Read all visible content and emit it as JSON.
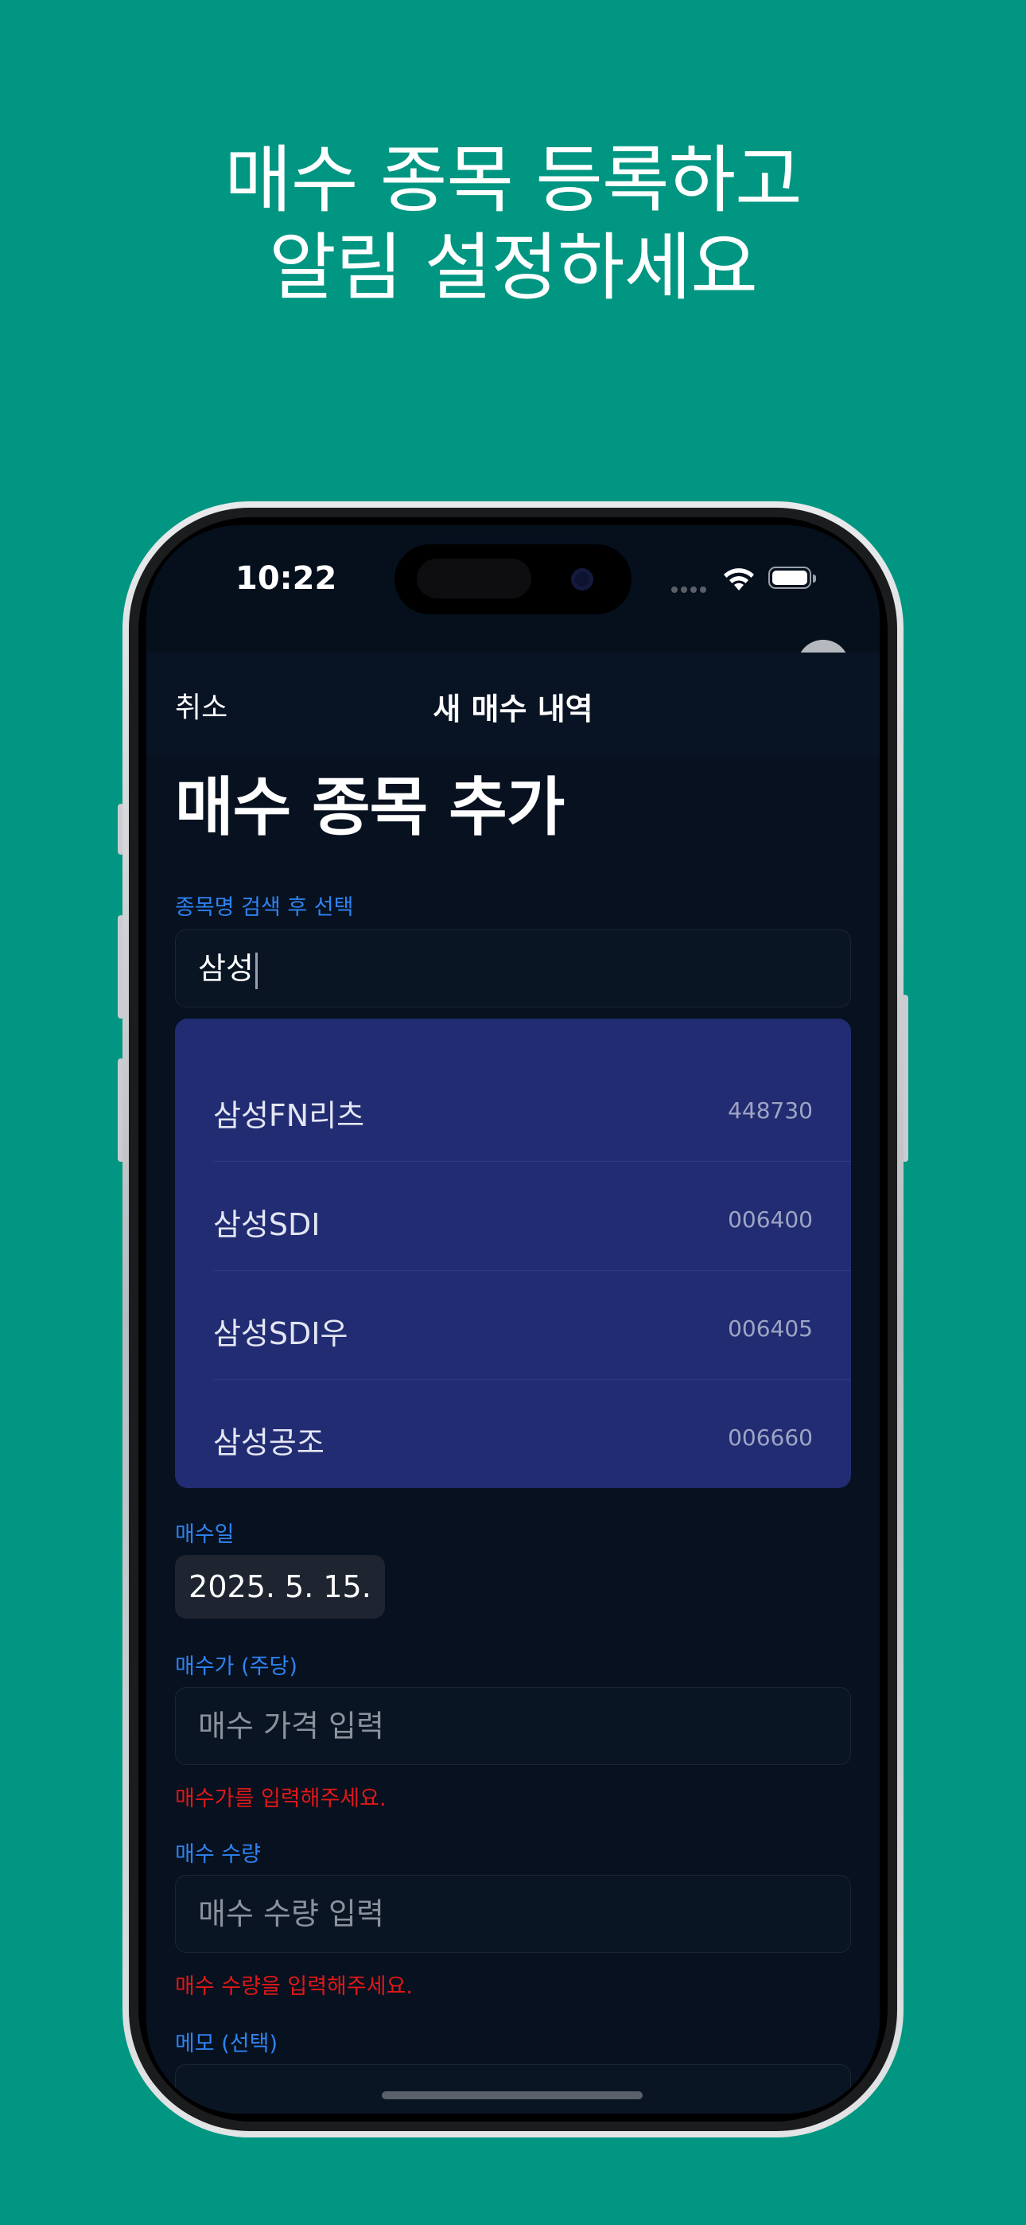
{
  "headline": [
    "매수 종목 등록하고",
    "알림 설정하세요"
  ],
  "status_bar": {
    "time": "10:22"
  },
  "nav": {
    "cancel": "취소",
    "title": "새 매수 내역"
  },
  "form": {
    "title": "매수 종목 추가",
    "search_label": "종목명 검색 후 선택",
    "search_value": "삼성",
    "suggestions": [
      {
        "name": "삼성FN리츠",
        "code": "448730"
      },
      {
        "name": "삼성SDI",
        "code": "006400"
      },
      {
        "name": "삼성SDI우",
        "code": "006405"
      },
      {
        "name": "삼성공조",
        "code": "006660"
      }
    ],
    "date_label": "매수일",
    "date_value": "2025. 5. 15.",
    "price_label": "매수가 (주당)",
    "price_placeholder": "매수 가격 입력",
    "price_error": "매수가를 입력해주세요.",
    "qty_label": "매수 수량",
    "qty_placeholder": "매수 수량 입력",
    "qty_error": "매수 수량을 입력해주세요.",
    "memo_label": "메모 (선택)"
  },
  "colors": {
    "background": "#009682",
    "screen": "#07111f",
    "accent_label": "#2e83f2",
    "error": "#e01818",
    "suggestion_panel": "#222c72"
  }
}
